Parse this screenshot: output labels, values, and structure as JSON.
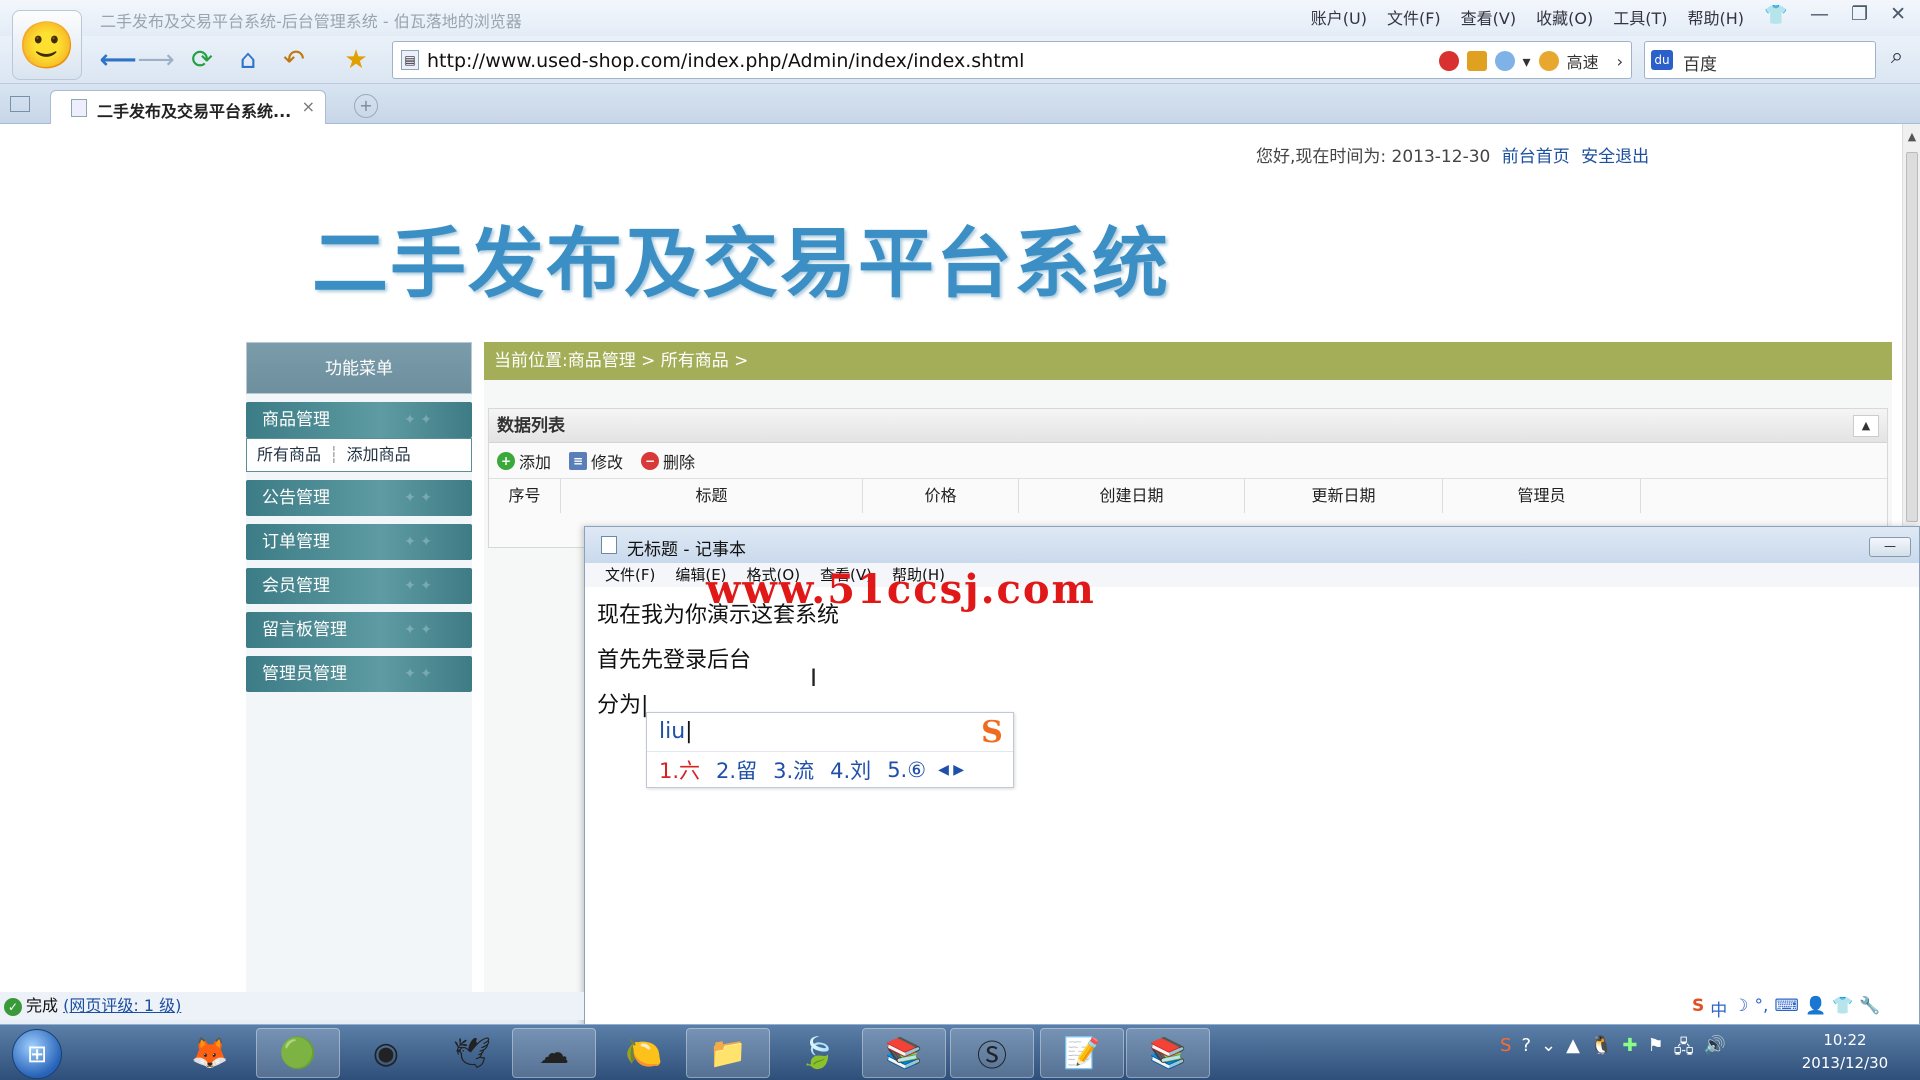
{
  "browser": {
    "window_title": "二手发布及交易平台系统-后台管理系统 - 伯瓦落地的浏览器",
    "menu": [
      "账户(U)",
      "文件(F)",
      "查看(V)",
      "收藏(O)",
      "工具(T)",
      "帮助(H)"
    ],
    "url": "http://www.used-shop.com/index.php/Admin/index/index.shtml",
    "speed_label": "高速",
    "search_engine": "百度",
    "tab_title": "二手发布及交易平台系统...",
    "status_text": "完成",
    "status_link": "(网页评级: 1 级)"
  },
  "header": {
    "greeting": "您好,现在时间为: 2013-12-30",
    "link_home": "前台首页",
    "link_logout": "安全退出",
    "site_title": "二手发布及交易平台系统"
  },
  "sidebar": {
    "title": "功能菜单",
    "groups": [
      {
        "label": "商品管理"
      },
      {
        "label": "公告管理"
      },
      {
        "label": "订单管理"
      },
      {
        "label": "会员管理"
      },
      {
        "label": "留言板管理"
      },
      {
        "label": "管理员管理"
      }
    ],
    "submenu": [
      "所有商品",
      "添加商品"
    ]
  },
  "main": {
    "breadcrumb": "当前位置:商品管理 > 所有商品 >",
    "panel_title": "数据列表",
    "actions": [
      "添加",
      "修改",
      "删除"
    ],
    "columns": [
      "序号",
      "标题",
      "价格",
      "创建日期",
      "更新日期",
      "管理员"
    ]
  },
  "notepad": {
    "title": "无标题 - 记事本",
    "menu": [
      "文件(F)",
      "编辑(E)",
      "格式(O)",
      "查看(V)",
      "帮助(H)"
    ],
    "lines": [
      "现在我为你演示这套系统",
      "首先先登录后台",
      "分为"
    ],
    "watermark": "www.51ccsj.com"
  },
  "ime": {
    "input": "liu",
    "candidates": [
      "1.六",
      "2.留",
      "3.流",
      "4.刘",
      "5.⑥"
    ]
  },
  "taskbar": {
    "time": "10:22",
    "date": "2013/12/30"
  },
  "colors": {
    "breadcrumb_bg": "#a4ae58",
    "menu_group_bg": "#4a8790",
    "title_blue": "#3b8fc5",
    "watermark_red": "#e01818"
  }
}
